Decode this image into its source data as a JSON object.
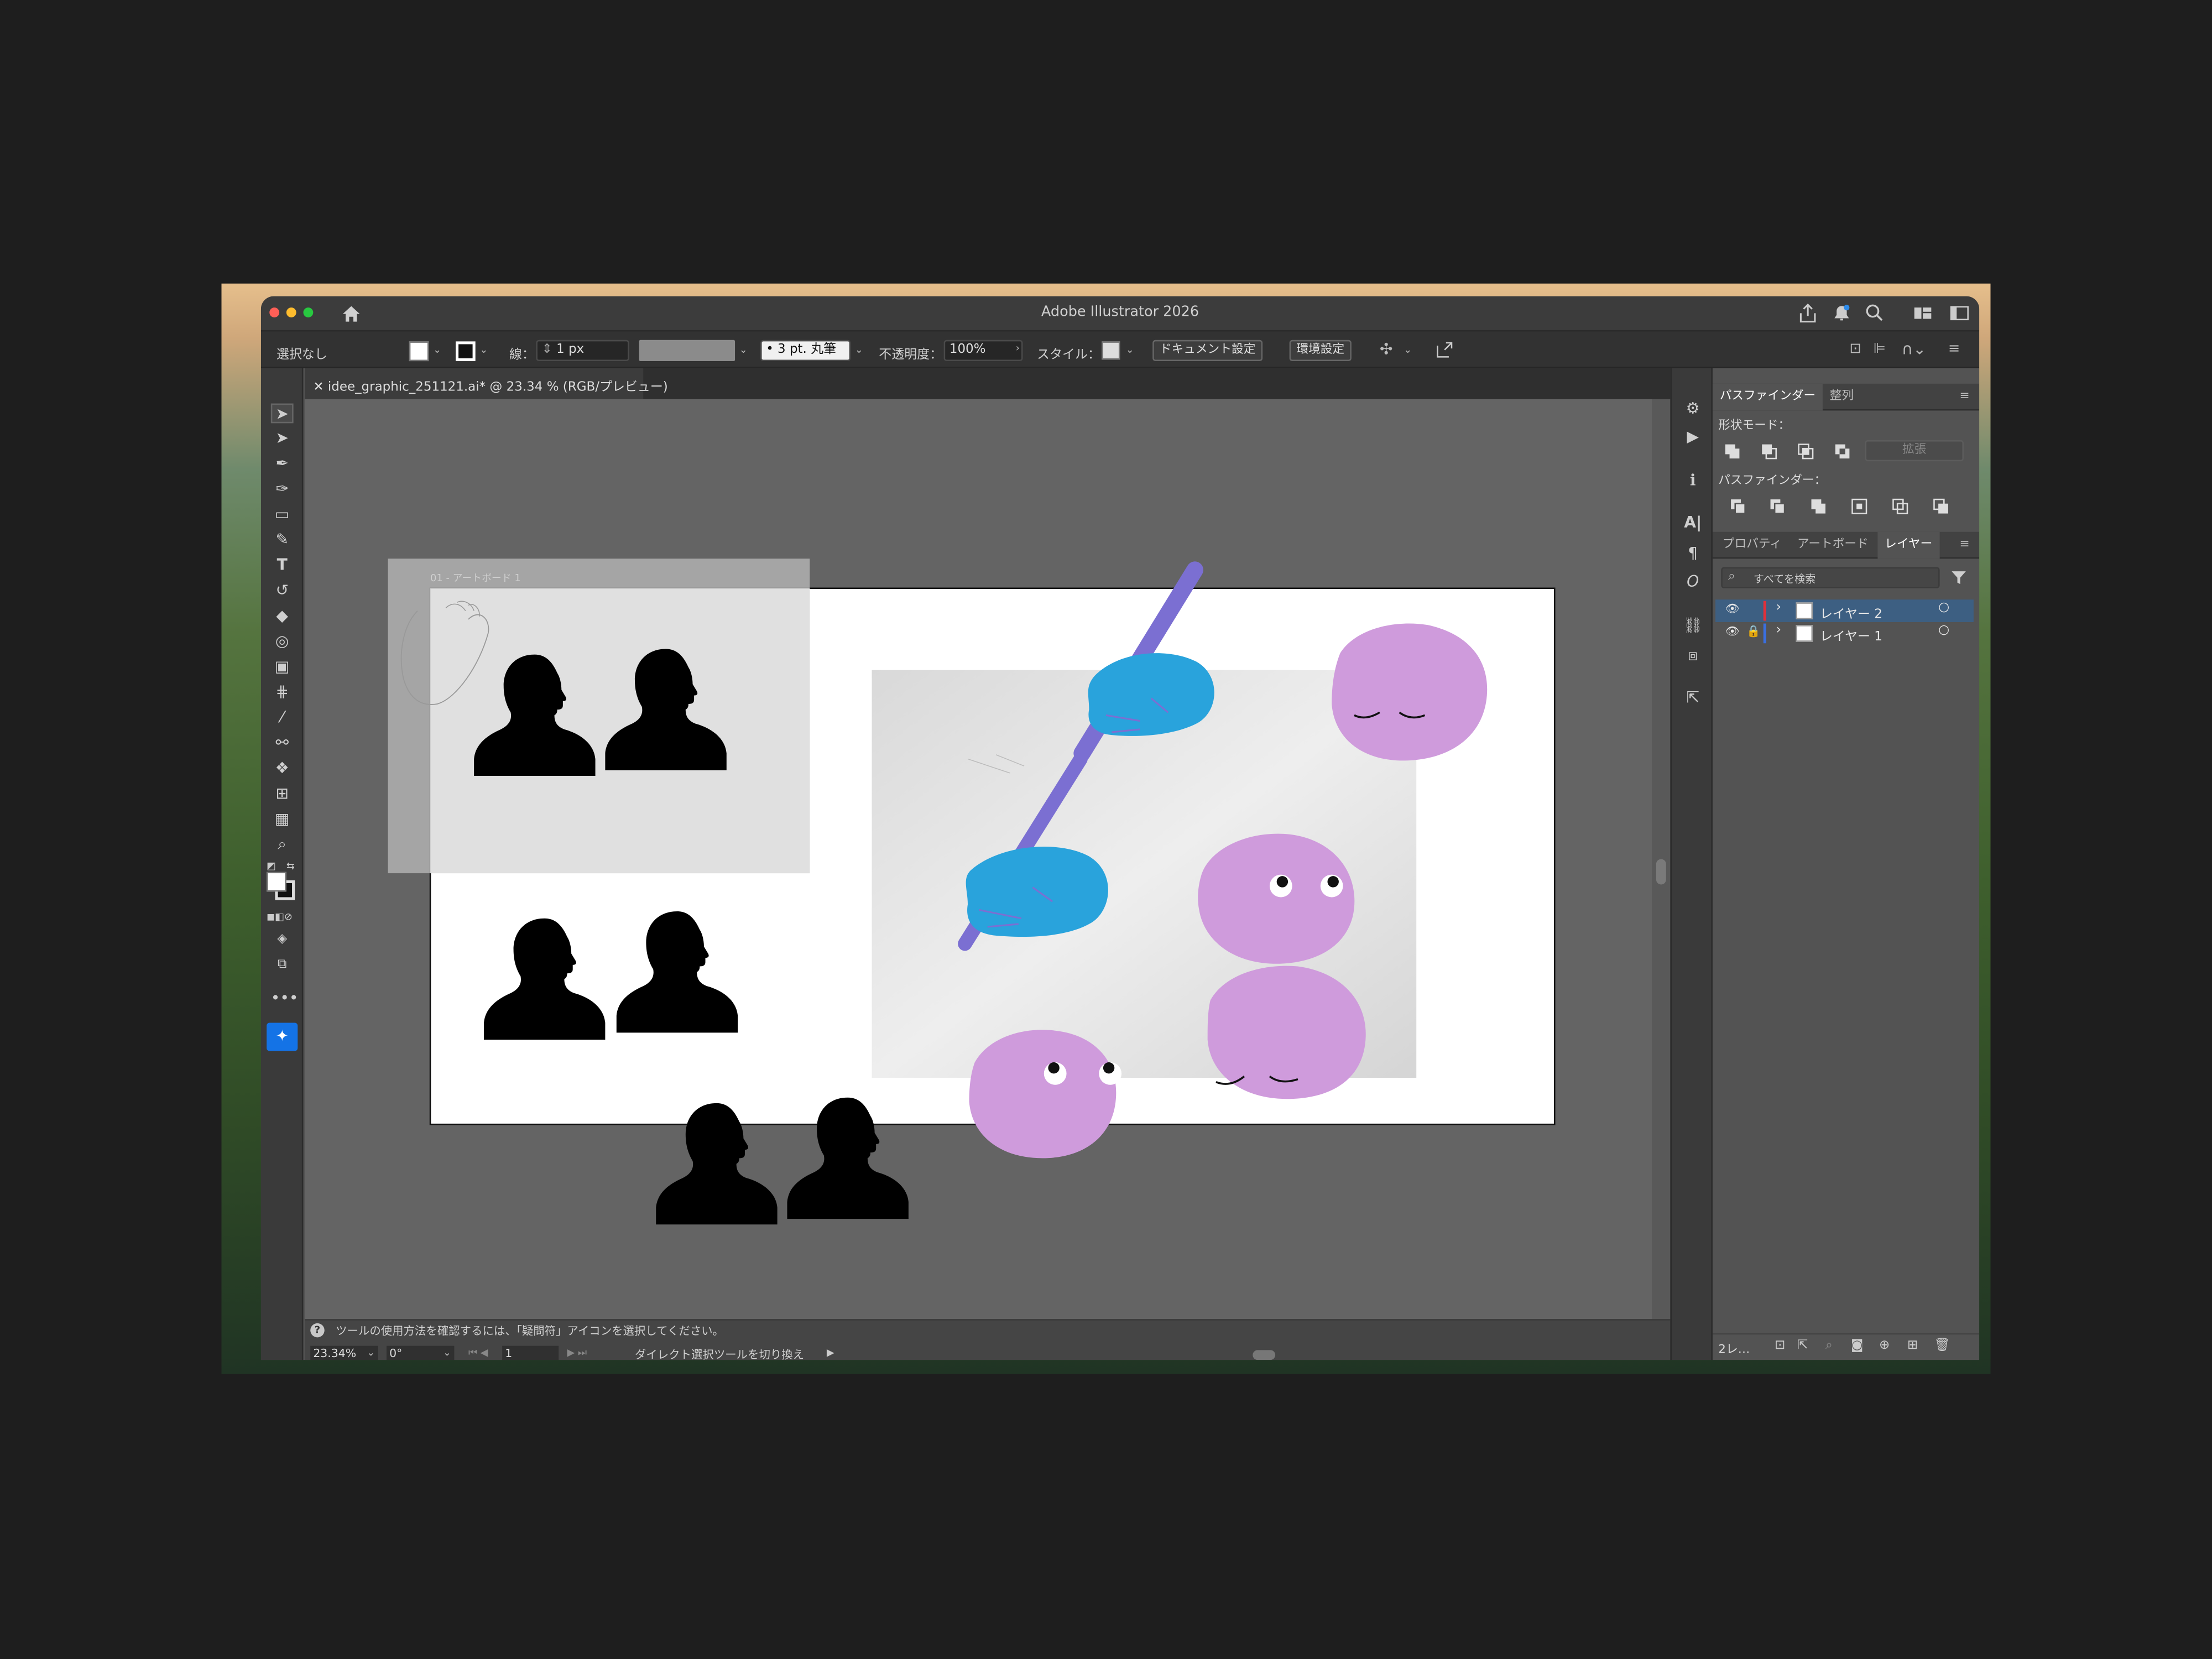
{
  "app": {
    "title": "Adobe Illustrator 2026"
  },
  "control": {
    "selection": "選択なし",
    "stroke_label": "線：",
    "stroke_weight": "1 px",
    "brush": "3 pt. 丸筆",
    "opacity_label": "不透明度：",
    "opacity": "100%",
    "style_label": "スタイル：",
    "doc_setup": "ドキュメント設定",
    "prefs": "環境設定"
  },
  "document": {
    "tab_title": "idee_graphic_251121.ai* @ 23.34 % (RGB/プレビュー)",
    "artboard_label": "01 - アートボード 1"
  },
  "statusbar": {
    "help": "ツールの使用方法を確認するには、「疑問符」アイコンを選択してください。",
    "zoom": "23.34%",
    "rotation": "0°",
    "artboard_num": "1",
    "tool_info": "ダイレクト選択ツールを切り換え"
  },
  "pathfinder": {
    "tabs": [
      "パスファインダー",
      "整列"
    ],
    "shape_modes": "形状モード：",
    "expand": "拡張",
    "pathfinders": "パスファインダー："
  },
  "layers": {
    "tabs": [
      "プロパティ",
      "アートボード",
      "レイヤー"
    ],
    "search_placeholder": "すべてを検索",
    "items": [
      {
        "name": "レイヤー 2",
        "color": "#e0303a"
      },
      {
        "name": "レイヤー 1",
        "color": "#3a6fe0"
      }
    ],
    "count": "2レ…"
  },
  "colors": {
    "hand": "#29a3dc",
    "pen": "#7b6fd2",
    "blob": "#cf9bdc",
    "selection_highlight": "#3d5f82"
  }
}
